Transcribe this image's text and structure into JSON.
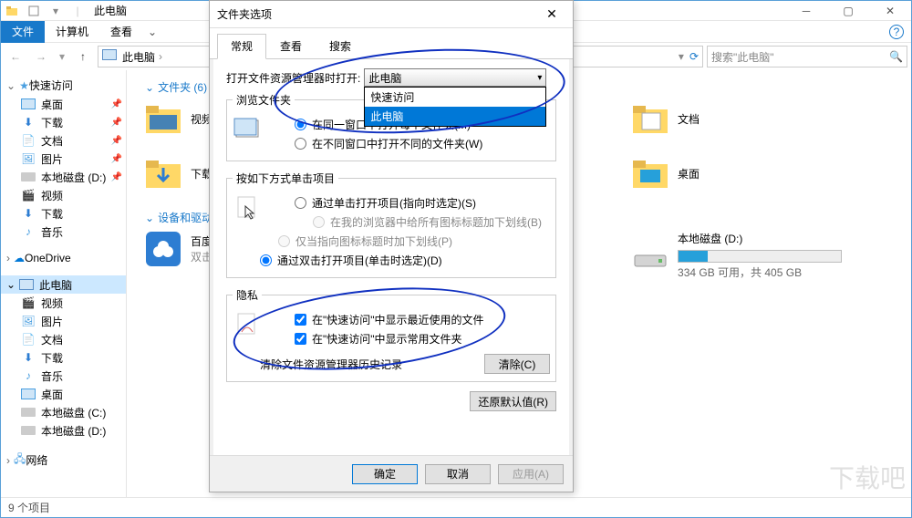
{
  "window": {
    "title": "此电脑",
    "tabs": {
      "file": "文件",
      "computer": "计算机",
      "view": "查看"
    }
  },
  "address": {
    "location": "此电脑",
    "search_placeholder": "搜索\"此电脑\""
  },
  "nav": {
    "quick_access": "快速访问",
    "items_qa": [
      {
        "label": "桌面",
        "pinned": true
      },
      {
        "label": "下载",
        "pinned": true
      },
      {
        "label": "文档",
        "pinned": true
      },
      {
        "label": "图片",
        "pinned": true
      },
      {
        "label": "本地磁盘 (D:)",
        "pinned": true
      },
      {
        "label": "视频",
        "pinned": false
      },
      {
        "label": "下载",
        "pinned": false
      },
      {
        "label": "音乐",
        "pinned": false
      }
    ],
    "onedrive": "OneDrive",
    "this_pc": "此电脑",
    "items_pc": [
      "视频",
      "图片",
      "文档",
      "下载",
      "音乐",
      "桌面",
      "本地磁盘 (C:)",
      "本地磁盘 (D:)"
    ],
    "network": "网络"
  },
  "content": {
    "folders_hdr": "文件夹 (6)",
    "devices_hdr": "设备和驱动",
    "col1": [
      {
        "label": "视频"
      },
      {
        "label": "下载"
      }
    ],
    "sub_item": {
      "label": "百度",
      "sub": "双击"
    },
    "col2": [
      {
        "label": "文档"
      },
      {
        "label": "桌面"
      }
    ],
    "drive": {
      "label": "本地磁盘 (D:)",
      "free_text": "334 GB 可用，共 405 GB",
      "used_pct": 18
    }
  },
  "status": {
    "text": "9 个项目"
  },
  "dialog": {
    "title": "文件夹选项",
    "tabs": [
      "常规",
      "查看",
      "搜索"
    ],
    "open_label": "打开文件资源管理器时打开:",
    "open_selected": "此电脑",
    "open_options": [
      "快速访问",
      "此电脑"
    ],
    "browse_legend": "浏览文件夹",
    "browse_r1": "在同一窗口中打开每个文件夹(M)",
    "browse_r2": "在不同窗口中打开不同的文件夹(W)",
    "click_legend": "按如下方式单击项目",
    "click_r1": "通过单击打开项目(指向时选定)(S)",
    "click_r1a": "在我的浏览器中给所有图标标题加下划线(B)",
    "click_r1b": "仅当指向图标标题时加下划线(P)",
    "click_r2": "通过双击打开项目(单击时选定)(D)",
    "privacy_legend": "隐私",
    "priv_c1": "在\"快速访问\"中显示最近使用的文件",
    "priv_c2": "在\"快速访问\"中显示常用文件夹",
    "clear_label": "清除文件资源管理器历史记录",
    "clear_btn": "清除(C)",
    "restore_btn": "还原默认值(R)",
    "ok": "确定",
    "cancel": "取消",
    "apply": "应用(A)"
  }
}
